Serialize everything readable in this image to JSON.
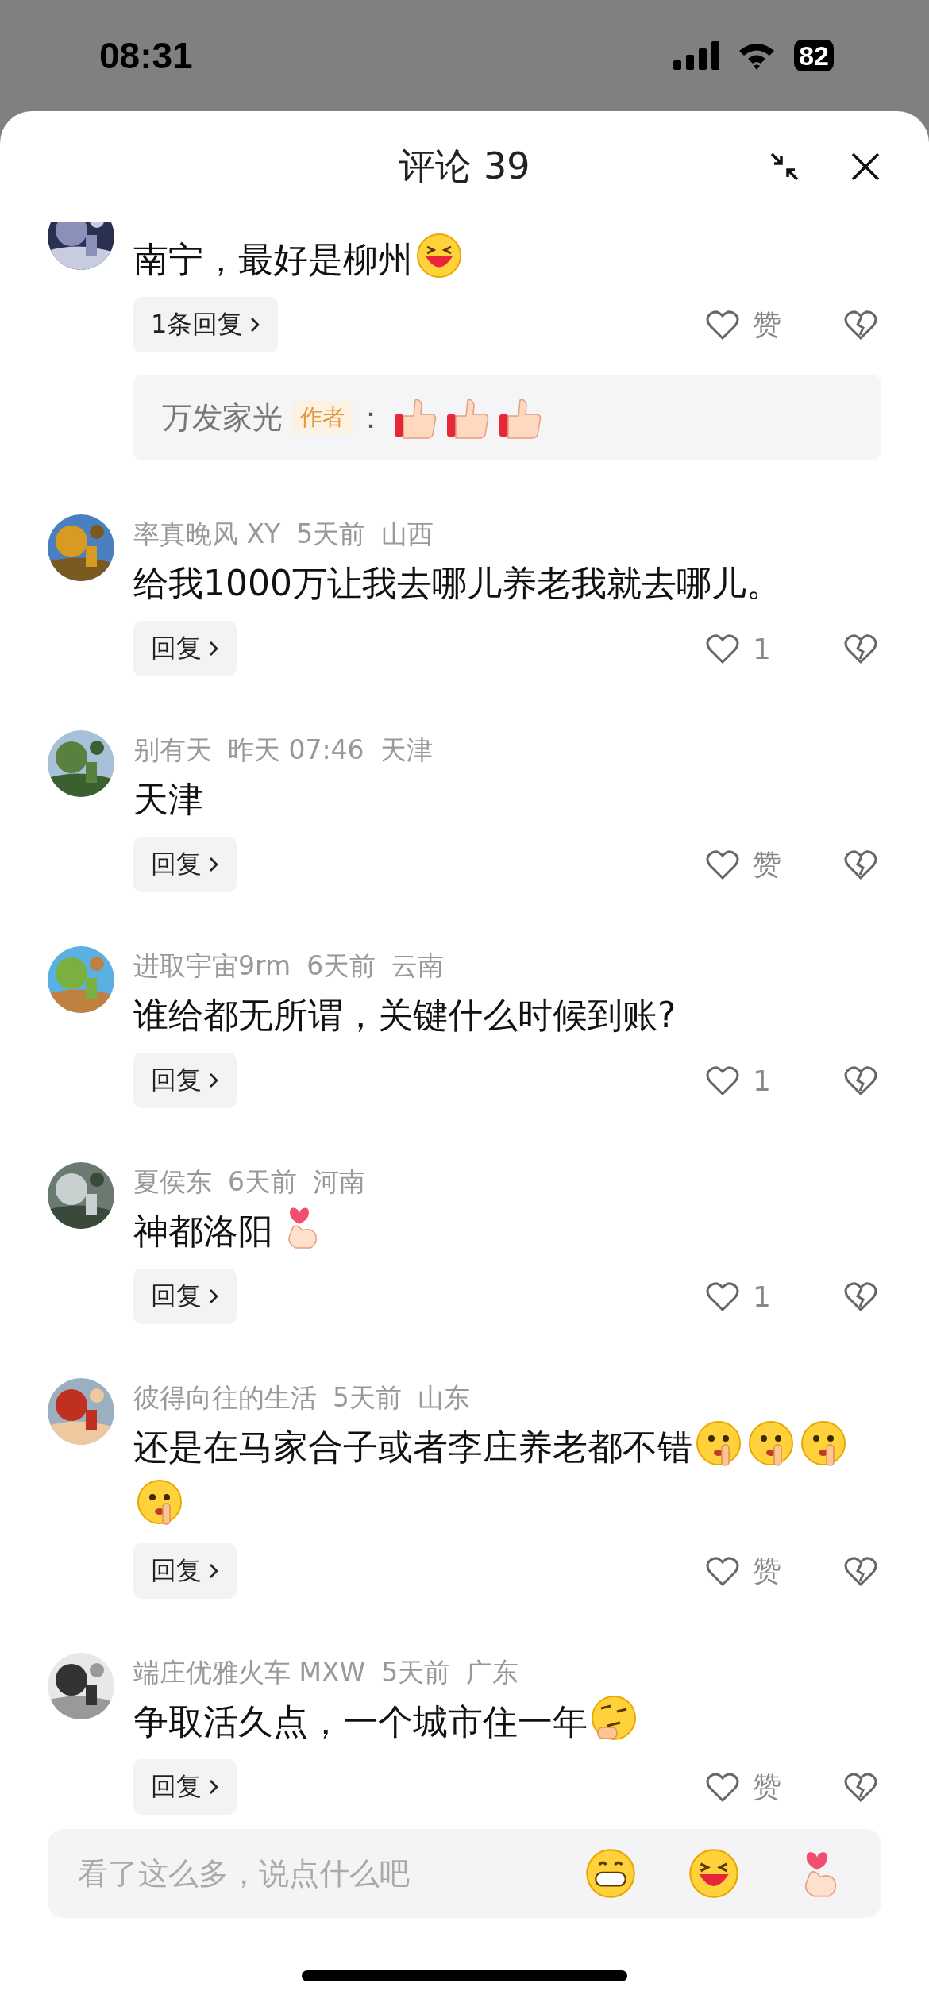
{
  "status_bar": {
    "time": "08:31",
    "battery": "82"
  },
  "header": {
    "title": "评论 39"
  },
  "comments": [
    {
      "text": "南宁，最好是柳州",
      "emojis": [
        {
          "kind": "laugh"
        }
      ],
      "reply_button": "1条回复",
      "like": "赞",
      "reply_preview": {
        "name": "万发家光",
        "tag": "作者",
        "separator": "：",
        "emojis": [
          {
            "kind": "thumbs"
          },
          {
            "kind": "thumbs"
          },
          {
            "kind": "thumbs"
          }
        ]
      }
    },
    {
      "user": "率真晚风 XY",
      "time": "5天前",
      "location": "山西",
      "text": "给我1000万让我去哪儿养老我就去哪儿。",
      "reply_button": "回复",
      "like": "1"
    },
    {
      "user": "别有天",
      "time": "昨天 07:46",
      "location": "天津",
      "text": "天津",
      "reply_button": "回复",
      "like": "赞"
    },
    {
      "user": "进取宇宙9rm",
      "time": "6天前",
      "location": "云南",
      "text": "谁给都无所谓，关键什么时候到账?",
      "reply_button": "回复",
      "like": "1"
    },
    {
      "user": "夏侯东",
      "time": "6天前",
      "location": "河南",
      "text": "神都洛阳",
      "emojis": [
        {
          "kind": "heart-hand"
        }
      ],
      "reply_button": "回复",
      "like": "1"
    },
    {
      "user": "彼得向往的生活",
      "time": "5天前",
      "location": "山东",
      "text": "还是在马家合子或者李庄养老都不错",
      "emojis": [
        {
          "kind": "shush"
        },
        {
          "kind": "shush"
        },
        {
          "kind": "shush"
        },
        {
          "kind": "shush"
        }
      ],
      "reply_button": "回复",
      "like": "赞"
    },
    {
      "user": "端庄优雅火车 MXW",
      "time": "5天前",
      "location": "广东",
      "text": "争取活久点，一个城市住一年",
      "emojis": [
        {
          "kind": "thinking"
        }
      ],
      "reply_button": "回复",
      "like": "赞"
    }
  ],
  "input": {
    "placeholder": "看了这么多，说点什么吧",
    "emojis": [
      {
        "kind": "grin"
      },
      {
        "kind": "laugh"
      },
      {
        "kind": "heart-hand"
      }
    ]
  }
}
